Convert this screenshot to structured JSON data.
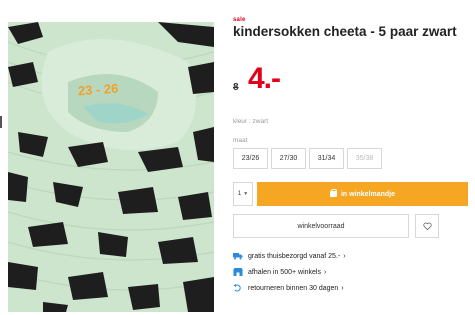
{
  "product": {
    "sale_tag": "sale",
    "title": "kindersokken cheeta - 5 paar zwart",
    "old_price": "8",
    "new_price": "4.-"
  },
  "color": {
    "label": "kleur : zwart"
  },
  "size": {
    "label": "maat",
    "options": [
      {
        "label": "23/26",
        "available": true
      },
      {
        "label": "27/30",
        "available": true
      },
      {
        "label": "31/34",
        "available": true
      },
      {
        "label": "35/38",
        "available": false
      }
    ]
  },
  "cart": {
    "quantity": "1",
    "button_label": "in winkelmandje"
  },
  "store": {
    "button_label": "winkelvoorraad"
  },
  "benefits": [
    {
      "icon": "truck-icon",
      "text": "gratis thuisbezorgd vanaf 25.-"
    },
    {
      "icon": "store-icon",
      "text": "afhalen in 500+ winkels"
    },
    {
      "icon": "return-icon",
      "text": "retourneren binnen 30 dagen"
    }
  ],
  "image": {
    "print_text": "23 - 26"
  },
  "colors": {
    "accent_red": "#e2001a",
    "cart_orange": "#f5a623",
    "icon_blue": "#2b8ad9",
    "sock_mint": "#cfe6cf"
  }
}
